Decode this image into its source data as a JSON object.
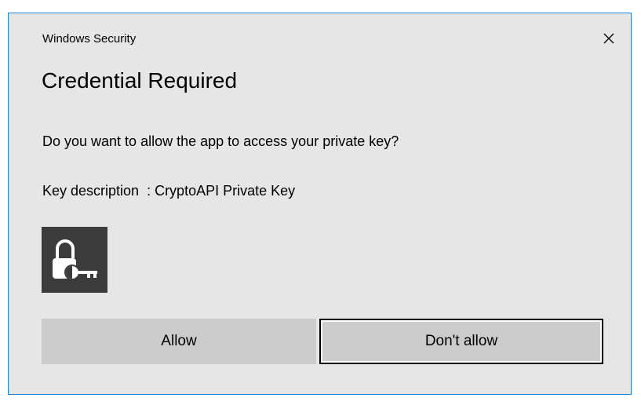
{
  "window": {
    "title": "Windows Security",
    "close_icon": "close-icon"
  },
  "content": {
    "heading": "Credential Required",
    "question": "Do you want to allow the app to access your private key?",
    "key_description": "Key description  : CryptoAPI Private Key",
    "tile_icon": "lock-key-icon"
  },
  "buttons": {
    "allow_label": "Allow",
    "deny_label": "Don't allow"
  },
  "colors": {
    "dialog_background": "#e6e6e6",
    "border_accent": "#1883d7",
    "button_background": "#cccccc",
    "icon_tile": "#3b3b3b"
  }
}
